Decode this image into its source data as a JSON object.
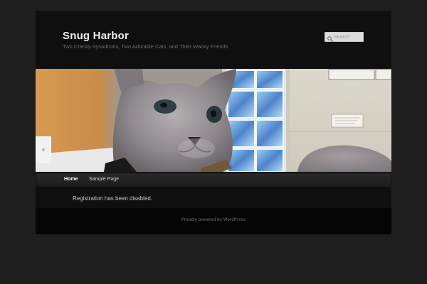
{
  "site": {
    "title": "Snug Harbor",
    "description": "Two Cranky Sysadmins, Two Adorable Cats, and Their Wacky Friends"
  },
  "search": {
    "placeholder": "Search",
    "icon": "magnifier-icon"
  },
  "header_image": {
    "content": "photo of a grey kitten beside a glass-block window, with another grey cat resting in the lower right"
  },
  "nav": {
    "items": [
      {
        "label": "Home",
        "current": true
      },
      {
        "label": "Sample Page",
        "current": false
      }
    ]
  },
  "main": {
    "message": "Registration has been disabled."
  },
  "footer": {
    "credit": "Proudly powered by WordPress"
  },
  "colors": {
    "page_background": "#1e1e1e",
    "content_background": "#0f0f0f",
    "footer_background": "#050505",
    "title_text": "#eeeeee"
  }
}
